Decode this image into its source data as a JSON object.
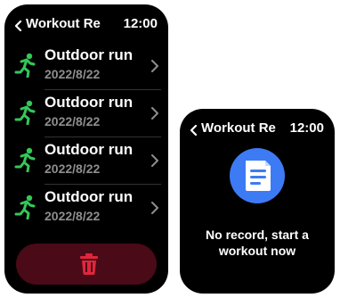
{
  "screens": [
    {
      "header": {
        "title": "Workout Re",
        "time": "12:00"
      },
      "records": [
        {
          "name": "Outdoor run",
          "date": "2022/8/22"
        },
        {
          "name": "Outdoor run",
          "date": "2022/8/22"
        },
        {
          "name": "Outdoor run",
          "date": "2022/8/22"
        },
        {
          "name": "Outdoor run",
          "date": "2022/8/22"
        }
      ],
      "icons": {
        "back": "chevron-left-icon",
        "record": "running-person-icon",
        "row_action": "chevron-right-icon",
        "delete": "trash-icon"
      }
    },
    {
      "header": {
        "title": "Workout Re",
        "time": "12:00"
      },
      "empty": {
        "message_line1": "No record, start a",
        "message_line2": "workout now"
      },
      "icons": {
        "back": "chevron-left-icon",
        "empty": "document-icon"
      }
    }
  ],
  "colors": {
    "accent_green": "#34c759",
    "delete_bg": "#4a0a17",
    "delete_red": "#e0263c",
    "doc_blue": "#3d7bf5",
    "date_gray": "#8e8e8e"
  }
}
